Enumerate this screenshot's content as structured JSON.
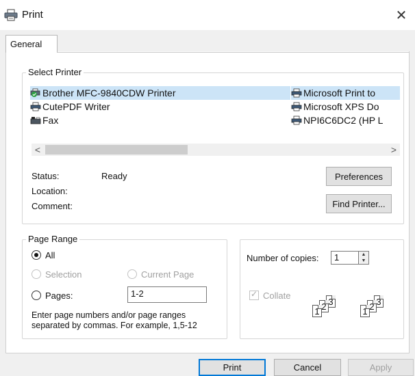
{
  "window": {
    "title": "Print",
    "close_glyph": "✕"
  },
  "tabs": [
    {
      "label": "General",
      "active": true
    }
  ],
  "select_printer": {
    "legend": "Select Printer",
    "printers_left": [
      {
        "name": "Brother MFC-9840CDW Printer",
        "icon": "default-printer-icon",
        "selected": true
      },
      {
        "name": "CutePDF Writer",
        "icon": "printer-icon"
      },
      {
        "name": "Fax",
        "icon": "fax-icon"
      }
    ],
    "printers_right": [
      {
        "name": "Microsoft Print to",
        "icon": "printer-icon"
      },
      {
        "name": "Microsoft XPS Do",
        "icon": "printer-icon"
      },
      {
        "name": "NPI6C6DC2 (HP L",
        "icon": "printer-icon"
      }
    ],
    "scroll_left": "<",
    "scroll_right": ">",
    "status_label": "Status:",
    "status_value": "Ready",
    "location_label": "Location:",
    "location_value": "",
    "comment_label": "Comment:",
    "comment_value": "",
    "preferences_button": "Preferences",
    "find_printer_button": "Find Printer..."
  },
  "page_range": {
    "legend": "Page Range",
    "all_label": "All",
    "selection_label": "Selection",
    "current_page_label": "Current Page",
    "pages_label": "Pages:",
    "pages_value": "1-2",
    "hint": "Enter page numbers and/or page ranges separated by commas.  For example, 1,5-12"
  },
  "copies": {
    "number_label": "Number of copies:",
    "number_value": "1",
    "collate_label": "Collate",
    "collate_checked": true,
    "page_digits": [
      "1",
      "2",
      "3"
    ]
  },
  "footer": {
    "print_button": "Print",
    "cancel_button": "Cancel",
    "apply_button": "Apply"
  },
  "colors": {
    "selection_bg": "#cce4f7",
    "default_button_border": "#0078d7",
    "dialog_bg": "#f0f0f0"
  }
}
